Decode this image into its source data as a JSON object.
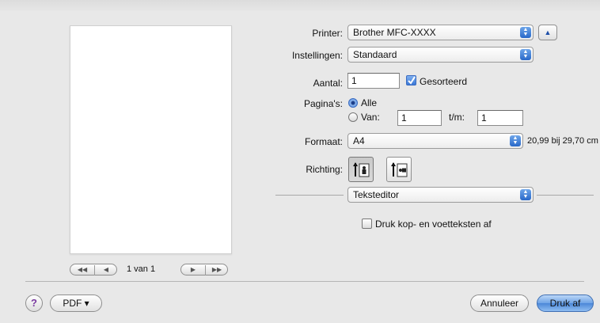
{
  "preview": {
    "page_indicator": "1 van 1",
    "nav_first_icon": "◀◀",
    "nav_prev_icon": "◀",
    "nav_next_icon": "▶",
    "nav_last_icon": "▶▶"
  },
  "form": {
    "printer_label": "Printer:",
    "printer_value": "Brother MFC-XXXX",
    "settings_label": "Instellingen:",
    "settings_value": "Standaard",
    "copies_label": "Aantal:",
    "copies_value": "1",
    "collated_label": "Gesorteerd",
    "collated_checked": true,
    "pages_label": "Pagina's:",
    "pages_all_label": "Alle",
    "pages_from_label": "Van:",
    "pages_from_value": "1",
    "pages_to_label": "t/m:",
    "pages_to_value": "1",
    "paper_label": "Formaat:",
    "paper_value": "A4",
    "paper_size_text": "20,99 bij 29,70 cm",
    "orientation_label": "Richting:",
    "section_value": "Teksteditor",
    "header_footer_label": "Druk kop- en voetteksten af"
  },
  "footer": {
    "help_icon": "?",
    "pdf_label": "PDF ▾",
    "cancel_label": "Annuleer",
    "print_label": "Druk af"
  },
  "colors": {
    "accent": "#4b87d8",
    "background": "#e8e8e8"
  }
}
